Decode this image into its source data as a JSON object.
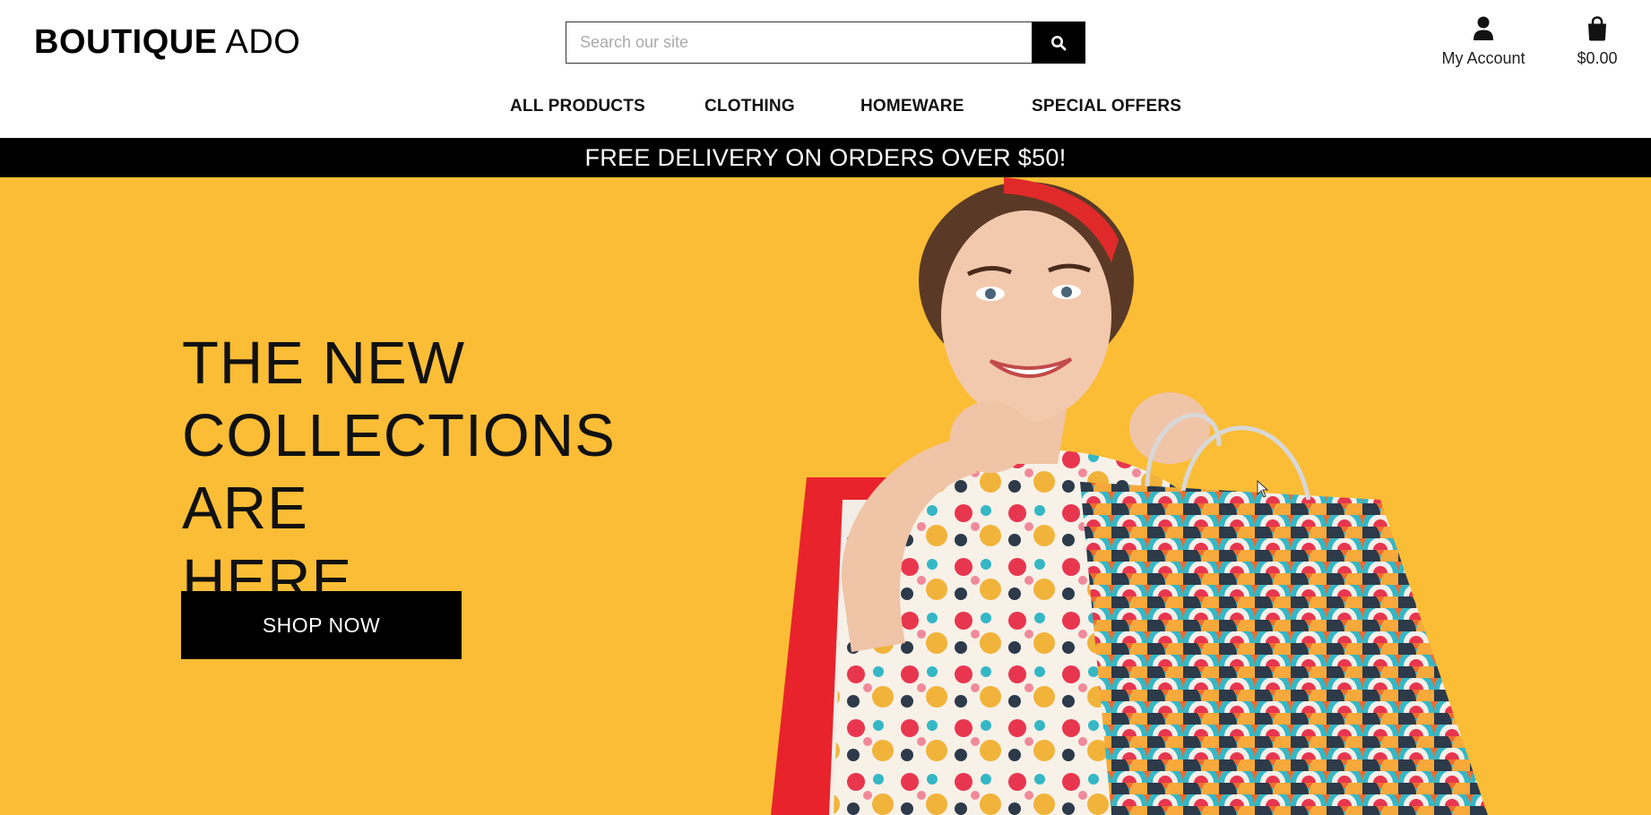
{
  "brand": {
    "name_bold": "BOUTIQUE",
    "name_light": " ADO"
  },
  "search": {
    "placeholder": "Search our site",
    "value": ""
  },
  "account": {
    "label": "My Account",
    "icon": "user-icon"
  },
  "bag": {
    "total": "$0.00",
    "icon": "shopping-bag-icon"
  },
  "nav": {
    "items": [
      {
        "label": "ALL PRODUCTS"
      },
      {
        "label": "CLOTHING"
      },
      {
        "label": "HOMEWARE"
      },
      {
        "label": "SPECIAL OFFERS"
      }
    ]
  },
  "banner": {
    "text": "FREE DELIVERY ON ORDERS OVER $50!"
  },
  "hero": {
    "title_line1": "THE NEW",
    "title_line2": "COLLECTIONS ARE",
    "title_line3": "HERE",
    "cta_label": "SHOP NOW",
    "background_color": "#fbbd35"
  },
  "colors": {
    "accent_black": "#000000",
    "hero_yellow": "#fbbd35"
  }
}
